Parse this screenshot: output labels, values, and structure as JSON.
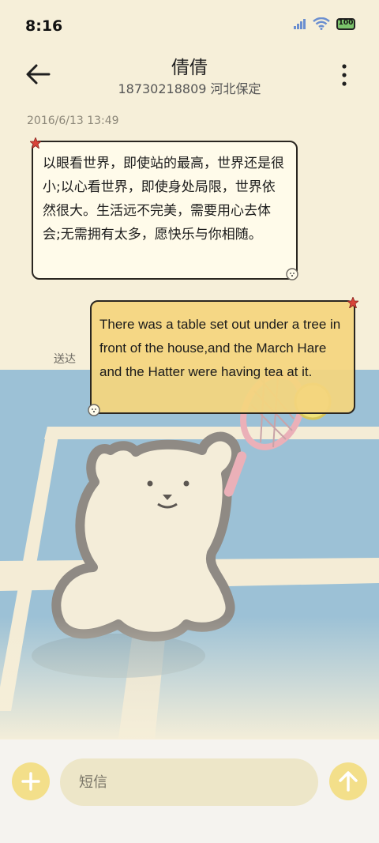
{
  "status_bar": {
    "time": "8:16",
    "battery": "100",
    "icons": [
      "signal-icon",
      "wifi-icon",
      "battery-icon"
    ]
  },
  "header": {
    "contact_name": "倩倩",
    "contact_subtitle": "18730218809 河北保定"
  },
  "conversation": {
    "timestamp": "2016/6/13 13:49",
    "messages": [
      {
        "direction": "incoming",
        "text": "以眼看世界，即使站的最高，世界还是很小;以心看世界，即使身处局限，世界依然很大。生活远不完美，需要用心去体会;无需拥有太多，愿快乐与你相随。"
      },
      {
        "direction": "outgoing",
        "text": "There was a table set out under a tree in front of the house,and the March Hare and the Hatter were having tea at it.",
        "status": "送达"
      }
    ]
  },
  "input_bar": {
    "placeholder": "短信"
  },
  "colors": {
    "background": "#f6efd9",
    "court_blue": "#9cc1d6",
    "incoming_bubble": "#fffbea",
    "outgoing_bubble": "#f4d57e",
    "button_yellow": "#f3df8a",
    "input_fill": "#ede6c8"
  }
}
